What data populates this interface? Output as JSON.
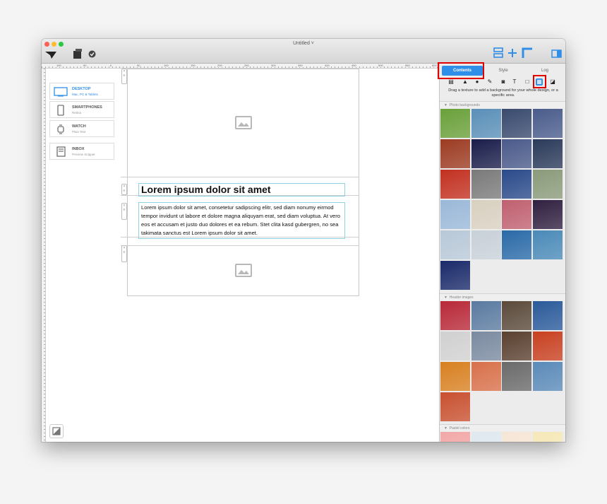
{
  "window": {
    "title": "Untitled ˅"
  },
  "ruler": {
    "labels": [
      "100",
      "50",
      "0",
      "50",
      "100",
      "150",
      "200",
      "250",
      "300",
      "350",
      "400",
      "450",
      "500",
      "550",
      "600"
    ]
  },
  "devices": [
    {
      "name": "DESKTOP",
      "sub": "Mac, PC & Tablets",
      "icon": "monitor-icon",
      "active": true
    },
    {
      "name": "SMARTPHONES",
      "sub": "Retina",
      "icon": "phone-icon",
      "active": false
    },
    {
      "name": "WATCH",
      "sub": "Plain Text",
      "icon": "watch-icon",
      "active": false
    },
    {
      "name": "INBOX",
      "sub": "Preview Snippet",
      "icon": "inbox-icon",
      "active": false
    }
  ],
  "canvas": {
    "headline": "Lorem ipsum dolor sit amet",
    "body": "Lorem ipsum dolor sit amet, consetetur sadipscing elitr, sed diam nonumy eirmod tempor invidunt ut labore et dolore magna aliquyam erat, sed diam voluptua. At vero eos et accusam et justo duo dolores et ea rebum. Stet clita kasd gubergren, no sea takimata sanctus est Lorem ipsum dolor sit amet."
  },
  "panel": {
    "tabs": [
      "Contents",
      "Style",
      "Log"
    ],
    "active_tab": "Contents",
    "tools": [
      "layout-icon",
      "triangle-icon",
      "circle-icon",
      "pen-icon",
      "camera-icon",
      "T",
      "square-icon",
      "texture-icon",
      "image-icon"
    ],
    "hint": "Drag a texture to add a background for your whole design, or a specific area.",
    "sections": [
      "Photo backgrounds",
      "Header images",
      "Pastel colors"
    ]
  },
  "colors": {
    "accent": "#2f8ee8",
    "highlight": "#e00000",
    "photo_thumbs": [
      "#6aa03a",
      "#5a8fb8",
      "#394a6e",
      "#4a5c8c",
      "#9c3b22",
      "#1a1d4a",
      "#4a5a8a",
      "#2a3a5a",
      "#c23020",
      "#7a7a7a",
      "#2a4a8a",
      "#8a9a7a",
      "#9ab8d8",
      "#d8d0c0",
      "#c06070",
      "#302040",
      "#b8c8d8",
      "#c8d0d8",
      "#2a6aa8",
      "#4a8ab8",
      "#1a2a6a"
    ],
    "header_thumbs": [
      "#b82838",
      "#5a7aa0",
      "#5a4a3a",
      "#2a5a9a",
      "#d0d0d0",
      "#7a8aa0",
      "#5a4030",
      "#c84020",
      "#d88020",
      "#d8704a",
      "#6a6a6a",
      "#5a8ab8",
      "#c85030"
    ],
    "pastel": [
      "#f2a8a8",
      "#e0e8f0",
      "#f6e6d6",
      "#f6e8b8"
    ]
  }
}
